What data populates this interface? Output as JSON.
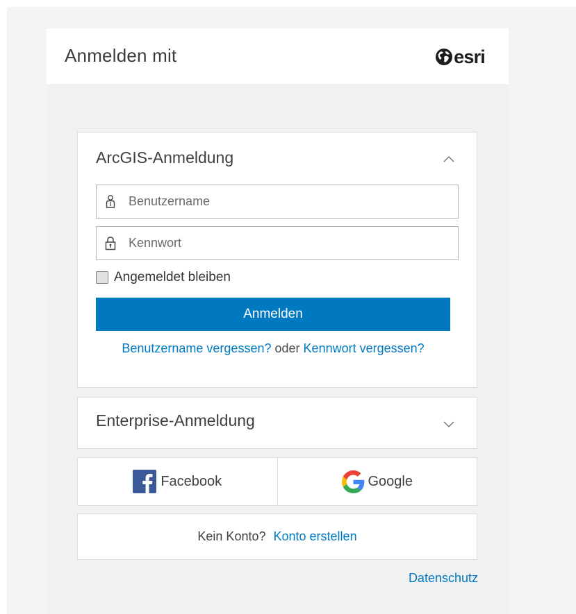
{
  "header": {
    "title": "Anmelden mit",
    "logo_text": "esri",
    "logo_icon": "globe-icon"
  },
  "arcgis": {
    "title": "ArcGIS-Anmeldung",
    "chevron_icon": "chevron-up-icon",
    "username_placeholder": "Benutzername",
    "username_value": "",
    "username_icon": "user-icon",
    "password_placeholder": "Kennwort",
    "password_value": "",
    "password_icon": "lock-icon",
    "remember_label": "Angemeldet bleiben",
    "remember_checked": false,
    "submit_label": "Anmelden",
    "forgot_username": "Benutzername vergessen?",
    "forgot_or": "oder",
    "forgot_password": "Kennwort vergessen?"
  },
  "enterprise": {
    "title": "Enterprise-Anmeldung",
    "chevron_icon": "chevron-down-icon"
  },
  "social": {
    "facebook_label": "Facebook",
    "google_label": "Google"
  },
  "account": {
    "prompt": "Kein Konto?",
    "create_link": "Konto erstellen"
  },
  "footer": {
    "privacy_link": "Datenschutz"
  },
  "colors": {
    "primary": "#0079c1",
    "facebook": "#3b5998"
  }
}
